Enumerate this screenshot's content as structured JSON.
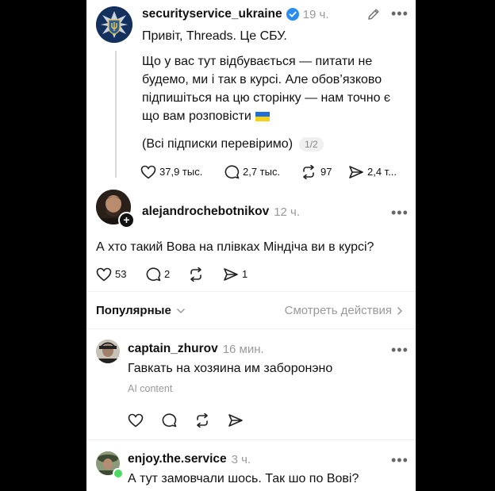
{
  "post": {
    "username": "securityservice_ukraine",
    "time": "19 ч.",
    "text_line1": "Привіт, Threads. Це СБУ.",
    "text_line2": "Що у вас тут відбувається — питати не",
    "text_line3": "будемо, ми і так в курсі. Але обов’язково",
    "text_line4": "підпишіться на цю сторінку — нам точно є",
    "text_line5": "що вам розповісти",
    "text_line6": "(Всі підписки перевіримо)",
    "page_indicator": "1/2",
    "likes": "37,9 тыс.",
    "comments": "2,7 тыс.",
    "reposts": "97",
    "shares": "2,4 т..."
  },
  "reply": {
    "username": "alejandrochebotnikov",
    "time": "12 ч.",
    "text": "А хто такий Вова на плівках Міндіча ви в курсі?",
    "likes": "53",
    "comments": "2",
    "shares": "1"
  },
  "sort": {
    "label": "Популярные",
    "activity_link": "Смотреть действия"
  },
  "comments": [
    {
      "username": "captain_zhurov",
      "time": "16 мин.",
      "text": "Гавкать на хозяина им заборонэно",
      "note": "AI content"
    },
    {
      "username": "enjoy.the.service",
      "time": "3 ч.",
      "text": "А тут замовчали шось. Так шо по Вові?"
    }
  ],
  "colors": {
    "verified": "#2b8cf0",
    "secondary_text": "#999999",
    "online": "#4cd964"
  }
}
